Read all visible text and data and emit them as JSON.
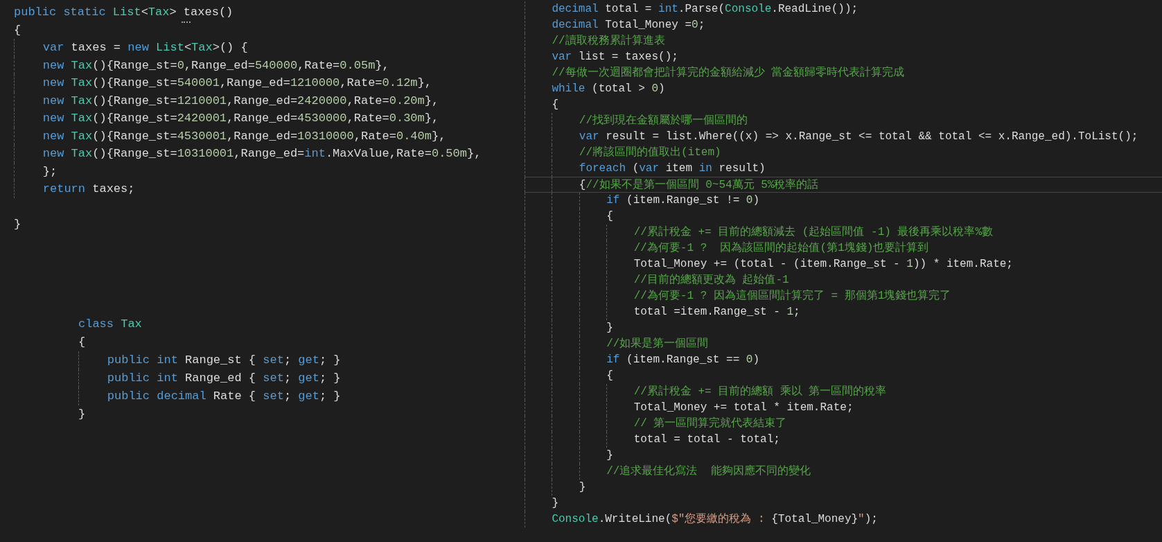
{
  "left_panel": {
    "method_code": [
      {
        "kind": "code",
        "tokens": [
          {
            "kind": "keyword",
            "text": "public"
          },
          {
            "kind": "keyword",
            "text": " static"
          },
          {
            "kind": "type",
            "text": " List"
          },
          {
            "kind": "plain",
            "text": "<"
          },
          {
            "kind": "type",
            "text": "Tax"
          },
          {
            "kind": "plain",
            "text": "> taxes()"
          }
        ]
      },
      {
        "kind": "code",
        "tokens": [
          {
            "kind": "plain",
            "text": "{"
          }
        ]
      },
      {
        "kind": "code",
        "tokens": [
          {
            "kind": "keyword",
            "text": "    var"
          },
          {
            "kind": "plain",
            "text": " taxes = "
          },
          {
            "kind": "keyword",
            "text": "new"
          },
          {
            "kind": "type",
            "text": " List"
          },
          {
            "kind": "plain",
            "text": "<"
          },
          {
            "kind": "type",
            "text": "Tax"
          },
          {
            "kind": "plain",
            "text": ">() {"
          }
        ]
      },
      {
        "kind": "code",
        "tokens": [
          {
            "kind": "keyword",
            "text": "    new"
          },
          {
            "kind": "type",
            "text": " Tax"
          },
          {
            "kind": "plain",
            "text": "(){Range_st="
          },
          {
            "kind": "number",
            "text": "0"
          },
          {
            "kind": "plain",
            "text": ",Range_ed="
          },
          {
            "kind": "number",
            "text": "540000"
          },
          {
            "kind": "plain",
            "text": ",Rate="
          },
          {
            "kind": "number",
            "text": "0.05m"
          },
          {
            "kind": "plain",
            "text": "},"
          }
        ]
      },
      {
        "kind": "code",
        "tokens": [
          {
            "kind": "keyword",
            "text": "    new"
          },
          {
            "kind": "type",
            "text": " Tax"
          },
          {
            "kind": "plain",
            "text": "(){Range_st="
          },
          {
            "kind": "number",
            "text": "540001"
          },
          {
            "kind": "plain",
            "text": ",Range_ed="
          },
          {
            "kind": "number",
            "text": "1210000"
          },
          {
            "kind": "plain",
            "text": ",Rate="
          },
          {
            "kind": "number",
            "text": "0.12m"
          },
          {
            "kind": "plain",
            "text": "},"
          }
        ]
      },
      {
        "kind": "code",
        "tokens": [
          {
            "kind": "keyword",
            "text": "    new"
          },
          {
            "kind": "type",
            "text": " Tax"
          },
          {
            "kind": "plain",
            "text": "(){Range_st="
          },
          {
            "kind": "number",
            "text": "1210001"
          },
          {
            "kind": "plain",
            "text": ",Range_ed="
          },
          {
            "kind": "number",
            "text": "2420000"
          },
          {
            "kind": "plain",
            "text": ",Rate="
          },
          {
            "kind": "number",
            "text": "0.20m"
          },
          {
            "kind": "plain",
            "text": "},"
          }
        ]
      },
      {
        "kind": "code",
        "tokens": [
          {
            "kind": "keyword",
            "text": "    new"
          },
          {
            "kind": "type",
            "text": " Tax"
          },
          {
            "kind": "plain",
            "text": "(){Range_st="
          },
          {
            "kind": "number",
            "text": "2420001"
          },
          {
            "kind": "plain",
            "text": ",Range_ed="
          },
          {
            "kind": "number",
            "text": "4530000"
          },
          {
            "kind": "plain",
            "text": ",Rate="
          },
          {
            "kind": "number",
            "text": "0.30m"
          },
          {
            "kind": "plain",
            "text": "},"
          }
        ]
      },
      {
        "kind": "code",
        "tokens": [
          {
            "kind": "keyword",
            "text": "    new"
          },
          {
            "kind": "type",
            "text": " Tax"
          },
          {
            "kind": "plain",
            "text": "(){Range_st="
          },
          {
            "kind": "number",
            "text": "4530001"
          },
          {
            "kind": "plain",
            "text": ",Range_ed="
          },
          {
            "kind": "number",
            "text": "10310000"
          },
          {
            "kind": "plain",
            "text": ",Rate="
          },
          {
            "kind": "number",
            "text": "0.40m"
          },
          {
            "kind": "plain",
            "text": "},"
          }
        ]
      },
      {
        "kind": "code",
        "tokens": [
          {
            "kind": "keyword",
            "text": "    new"
          },
          {
            "kind": "type",
            "text": " Tax"
          },
          {
            "kind": "plain",
            "text": "(){Range_st="
          },
          {
            "kind": "number",
            "text": "10310001"
          },
          {
            "kind": "plain",
            "text": ",Range_ed="
          },
          {
            "kind": "keyword",
            "text": "int"
          },
          {
            "kind": "plain",
            "text": ".MaxValue,Rate="
          },
          {
            "kind": "number",
            "text": "0.50m"
          },
          {
            "kind": "plain",
            "text": "},"
          }
        ]
      },
      {
        "kind": "code",
        "tokens": [
          {
            "kind": "plain",
            "text": "    };"
          }
        ]
      },
      {
        "kind": "code",
        "tokens": [
          {
            "kind": "keyword",
            "text": "    return"
          },
          {
            "kind": "plain",
            "text": " taxes;"
          }
        ]
      },
      {
        "kind": "blank"
      },
      {
        "kind": "code",
        "tokens": [
          {
            "kind": "plain",
            "text": "}"
          }
        ]
      }
    ],
    "class_code": [
      {
        "kind": "code",
        "tokens": [
          {
            "kind": "keyword",
            "text": "class"
          },
          {
            "kind": "type",
            "text": " Tax"
          }
        ]
      },
      {
        "kind": "code",
        "tokens": [
          {
            "kind": "plain",
            "text": "{"
          }
        ]
      },
      {
        "kind": "code",
        "tokens": [
          {
            "kind": "keyword",
            "text": "    public"
          },
          {
            "kind": "keyword",
            "text": " int"
          },
          {
            "kind": "plain",
            "text": " Range_st { "
          },
          {
            "kind": "keyword",
            "text": "set"
          },
          {
            "kind": "plain",
            "text": "; "
          },
          {
            "kind": "keyword",
            "text": "get"
          },
          {
            "kind": "plain",
            "text": "; }"
          }
        ]
      },
      {
        "kind": "code",
        "tokens": [
          {
            "kind": "keyword",
            "text": "    public"
          },
          {
            "kind": "keyword",
            "text": " int"
          },
          {
            "kind": "plain",
            "text": " Range_ed { "
          },
          {
            "kind": "keyword",
            "text": "set"
          },
          {
            "kind": "plain",
            "text": "; "
          },
          {
            "kind": "keyword",
            "text": "get"
          },
          {
            "kind": "plain",
            "text": "; }"
          }
        ]
      },
      {
        "kind": "code",
        "tokens": [
          {
            "kind": "keyword",
            "text": "    public"
          },
          {
            "kind": "keyword",
            "text": " decimal"
          },
          {
            "kind": "plain",
            "text": " Rate { "
          },
          {
            "kind": "keyword",
            "text": "set"
          },
          {
            "kind": "plain",
            "text": "; "
          },
          {
            "kind": "keyword",
            "text": "get"
          },
          {
            "kind": "plain",
            "text": "; }"
          }
        ]
      },
      {
        "kind": "code",
        "tokens": [
          {
            "kind": "plain",
            "text": "}"
          }
        ]
      }
    ]
  },
  "right_panel": {
    "code": [
      {
        "kind": "code",
        "tokens": [
          {
            "kind": "keyword",
            "text": "    decimal"
          },
          {
            "kind": "plain",
            "text": " total = "
          },
          {
            "kind": "keyword",
            "text": "int"
          },
          {
            "kind": "plain",
            "text": ".Parse("
          },
          {
            "kind": "type",
            "text": "Console"
          },
          {
            "kind": "plain",
            "text": ".ReadLine());"
          }
        ]
      },
      {
        "kind": "code",
        "tokens": [
          {
            "kind": "keyword",
            "text": "    decimal"
          },
          {
            "kind": "plain",
            "text": " Total_Money ="
          },
          {
            "kind": "number",
            "text": "0"
          },
          {
            "kind": "plain",
            "text": ";"
          }
        ]
      },
      {
        "kind": "code",
        "tokens": [
          {
            "kind": "comment",
            "text": "    //讀取稅務累計算進表"
          }
        ]
      },
      {
        "kind": "code",
        "tokens": [
          {
            "kind": "keyword",
            "text": "    var"
          },
          {
            "kind": "plain",
            "text": " list = taxes();"
          }
        ]
      },
      {
        "kind": "code",
        "tokens": [
          {
            "kind": "comment",
            "text": "    //每做一次迴圈都會把計算完的金額給減少 當金額歸零時代表計算完成"
          }
        ]
      },
      {
        "kind": "code",
        "tokens": [
          {
            "kind": "keyword",
            "text": "    while"
          },
          {
            "kind": "plain",
            "text": " (total > "
          },
          {
            "kind": "number",
            "text": "0"
          },
          {
            "kind": "plain",
            "text": ")"
          }
        ]
      },
      {
        "kind": "code",
        "tokens": [
          {
            "kind": "plain",
            "text": "    {"
          }
        ]
      },
      {
        "kind": "code",
        "tokens": [
          {
            "kind": "comment",
            "text": "        //找到現在金額屬於哪一個區間的"
          }
        ]
      },
      {
        "kind": "code",
        "tokens": [
          {
            "kind": "keyword",
            "text": "        var"
          },
          {
            "kind": "plain",
            "text": " result = list.Where((x) => x.Range_st <= total && total <= x.Range_ed).ToList();"
          }
        ]
      },
      {
        "kind": "code",
        "tokens": [
          {
            "kind": "comment",
            "text": "        //將該區間的值取出(item)"
          }
        ]
      },
      {
        "kind": "code",
        "tokens": [
          {
            "kind": "keyword",
            "text": "        foreach"
          },
          {
            "kind": "plain",
            "text": " ("
          },
          {
            "kind": "keyword",
            "text": "var"
          },
          {
            "kind": "plain",
            "text": " item "
          },
          {
            "kind": "keyword",
            "text": "in"
          },
          {
            "kind": "plain",
            "text": " result)"
          }
        ]
      },
      {
        "kind": "current",
        "tokens": [
          {
            "kind": "plain",
            "text": "        {"
          },
          {
            "kind": "comment",
            "text": "//如果不是第一個區間 0~54萬元 5%稅率的話"
          }
        ]
      },
      {
        "kind": "code",
        "tokens": [
          {
            "kind": "keyword",
            "text": "            if"
          },
          {
            "kind": "plain",
            "text": " (item.Range_st != "
          },
          {
            "kind": "number",
            "text": "0"
          },
          {
            "kind": "plain",
            "text": ")"
          }
        ]
      },
      {
        "kind": "code",
        "tokens": [
          {
            "kind": "plain",
            "text": "            {"
          }
        ]
      },
      {
        "kind": "code",
        "tokens": [
          {
            "kind": "comment",
            "text": "                //累計稅金 += 目前的總額減去 (起始區間值 -1) 最後再乘以稅率%數"
          }
        ]
      },
      {
        "kind": "code",
        "tokens": [
          {
            "kind": "comment",
            "text": "                //為何要-1 ?  因為該區間的起始值(第1塊錢)也要計算到"
          }
        ]
      },
      {
        "kind": "code",
        "tokens": [
          {
            "kind": "plain",
            "text": "                Total_Money += (total - (item.Range_st - "
          },
          {
            "kind": "number",
            "text": "1"
          },
          {
            "kind": "plain",
            "text": ")) * item.Rate;"
          }
        ]
      },
      {
        "kind": "code",
        "tokens": [
          {
            "kind": "comment",
            "text": "                //目前的總額更改為 起始值-1"
          }
        ]
      },
      {
        "kind": "code",
        "tokens": [
          {
            "kind": "comment",
            "text": "                //為何要-1 ? 因為這個區間計算完了 = 那個第1塊錢也算完了"
          }
        ]
      },
      {
        "kind": "code",
        "tokens": [
          {
            "kind": "plain",
            "text": "                total =item.Range_st - "
          },
          {
            "kind": "number",
            "text": "1"
          },
          {
            "kind": "plain",
            "text": ";"
          }
        ]
      },
      {
        "kind": "code",
        "tokens": [
          {
            "kind": "plain",
            "text": "            }"
          }
        ]
      },
      {
        "kind": "code",
        "tokens": [
          {
            "kind": "comment",
            "text": "            //如果是第一個區間"
          }
        ]
      },
      {
        "kind": "code",
        "tokens": [
          {
            "kind": "keyword",
            "text": "            if"
          },
          {
            "kind": "plain",
            "text": " (item.Range_st == "
          },
          {
            "kind": "number",
            "text": "0"
          },
          {
            "kind": "plain",
            "text": ")"
          }
        ]
      },
      {
        "kind": "code",
        "tokens": [
          {
            "kind": "plain",
            "text": "            {"
          }
        ]
      },
      {
        "kind": "code",
        "tokens": [
          {
            "kind": "comment",
            "text": "                //累計稅金 += 目前的總額 乘以 第一區間的稅率"
          }
        ]
      },
      {
        "kind": "code",
        "tokens": [
          {
            "kind": "plain",
            "text": "                Total_Money += total * item.Rate;"
          }
        ]
      },
      {
        "kind": "code",
        "tokens": [
          {
            "kind": "comment",
            "text": "                // 第一區間算完就代表結束了"
          }
        ]
      },
      {
        "kind": "code",
        "tokens": [
          {
            "kind": "plain",
            "text": "                total = total - total;"
          }
        ]
      },
      {
        "kind": "code",
        "tokens": [
          {
            "kind": "plain",
            "text": "            }"
          }
        ]
      },
      {
        "kind": "code",
        "tokens": [
          {
            "kind": "comment",
            "text": "            //追求最佳化寫法  能夠因應不同的變化"
          }
        ]
      },
      {
        "kind": "code",
        "tokens": [
          {
            "kind": "plain",
            "text": "        }"
          }
        ]
      },
      {
        "kind": "code",
        "tokens": [
          {
            "kind": "plain",
            "text": "    }"
          }
        ]
      },
      {
        "kind": "code",
        "tokens": [
          {
            "kind": "type",
            "text": "    Console"
          },
          {
            "kind": "plain",
            "text": ".WriteLine("
          },
          {
            "kind": "string",
            "text": "$\"您要繳的稅為 : "
          },
          {
            "kind": "plain",
            "text": "{Total_Money}"
          },
          {
            "kind": "string",
            "text": "\""
          },
          {
            "kind": "plain",
            "text": ");"
          }
        ]
      }
    ]
  }
}
